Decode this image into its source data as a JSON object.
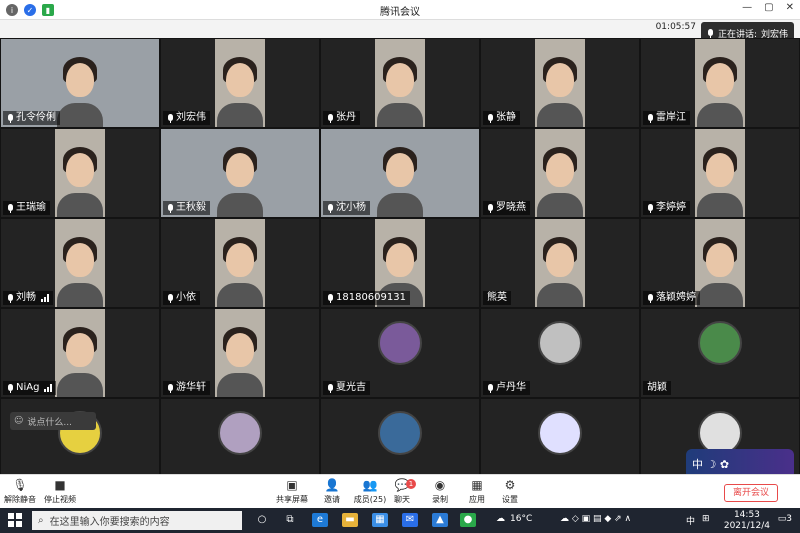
{
  "window": {
    "title": "腾讯会议",
    "min": "—",
    "max": "▢",
    "close": "✕"
  },
  "meeting": {
    "timer": "01:05:57",
    "speaking_label": "正在讲话:",
    "speaking_name": "刘宏伟"
  },
  "participants": [
    {
      "name": "孔令伶俐",
      "mic": true,
      "signal": false,
      "kind": "wide"
    },
    {
      "name": "刘宏伟",
      "mic": true,
      "signal": false,
      "kind": "video"
    },
    {
      "name": "张丹",
      "mic": true,
      "signal": false,
      "kind": "video"
    },
    {
      "name": "张静",
      "mic": true,
      "signal": false,
      "kind": "video"
    },
    {
      "name": "雷岸江",
      "mic": true,
      "signal": false,
      "kind": "video"
    },
    {
      "name": "王瑞瑜",
      "mic": true,
      "signal": false,
      "kind": "video"
    },
    {
      "name": "王秋毅",
      "mic": true,
      "signal": false,
      "kind": "wide"
    },
    {
      "name": "沈小杨",
      "mic": true,
      "signal": false,
      "kind": "wide"
    },
    {
      "name": "罗晓燕",
      "mic": true,
      "signal": false,
      "kind": "video"
    },
    {
      "name": "李婷婷",
      "mic": true,
      "signal": false,
      "kind": "video"
    },
    {
      "name": "刘畅",
      "mic": true,
      "signal": true,
      "kind": "video"
    },
    {
      "name": "小依",
      "mic": true,
      "signal": false,
      "kind": "video"
    },
    {
      "name": "18180609131",
      "mic": true,
      "signal": false,
      "kind": "video"
    },
    {
      "name": "熊英",
      "mic": false,
      "signal": false,
      "kind": "video"
    },
    {
      "name": "落颖娉婷",
      "mic": true,
      "signal": false,
      "kind": "video"
    },
    {
      "name": "NiAg",
      "mic": true,
      "signal": true,
      "kind": "video"
    },
    {
      "name": "游华轩",
      "mic": true,
      "signal": false,
      "kind": "video"
    },
    {
      "name": "夏光吉",
      "mic": true,
      "signal": false,
      "kind": "avatar"
    },
    {
      "name": "卢丹华",
      "mic": true,
      "signal": false,
      "kind": "avatar"
    },
    {
      "name": "胡颖",
      "mic": false,
      "signal": false,
      "kind": "avatar"
    },
    {
      "name": "",
      "mic": false,
      "signal": false,
      "kind": "avatar"
    },
    {
      "name": "",
      "mic": false,
      "signal": false,
      "kind": "avatar"
    },
    {
      "name": "",
      "mic": false,
      "signal": false,
      "kind": "avatar"
    },
    {
      "name": "",
      "mic": false,
      "signal": false,
      "kind": "avatar"
    },
    {
      "name": "",
      "mic": false,
      "signal": false,
      "kind": "avatar"
    }
  ],
  "chat": {
    "placeholder": "说点什么..."
  },
  "deco": {
    "text": "中 ☽ ✿"
  },
  "toolbar": {
    "unmute": "解除静音",
    "stop_video": "停止视频",
    "share": "共享屏幕",
    "invite": "邀请",
    "members": "成员(25)",
    "chat": "聊天",
    "chat_badge": "1",
    "record": "录制",
    "apps": "应用",
    "settings": "设置",
    "leave": "离开会议"
  },
  "taskbar": {
    "search_placeholder": "在这里输入你要搜索的内容",
    "weather": "16°C",
    "ime": "中",
    "time": "14:53",
    "date": "2021/12/4",
    "notif": "3"
  },
  "colors": {
    "accent": "#0a6cff",
    "leave": "#e84a4a",
    "tile_bg": "#232323"
  }
}
